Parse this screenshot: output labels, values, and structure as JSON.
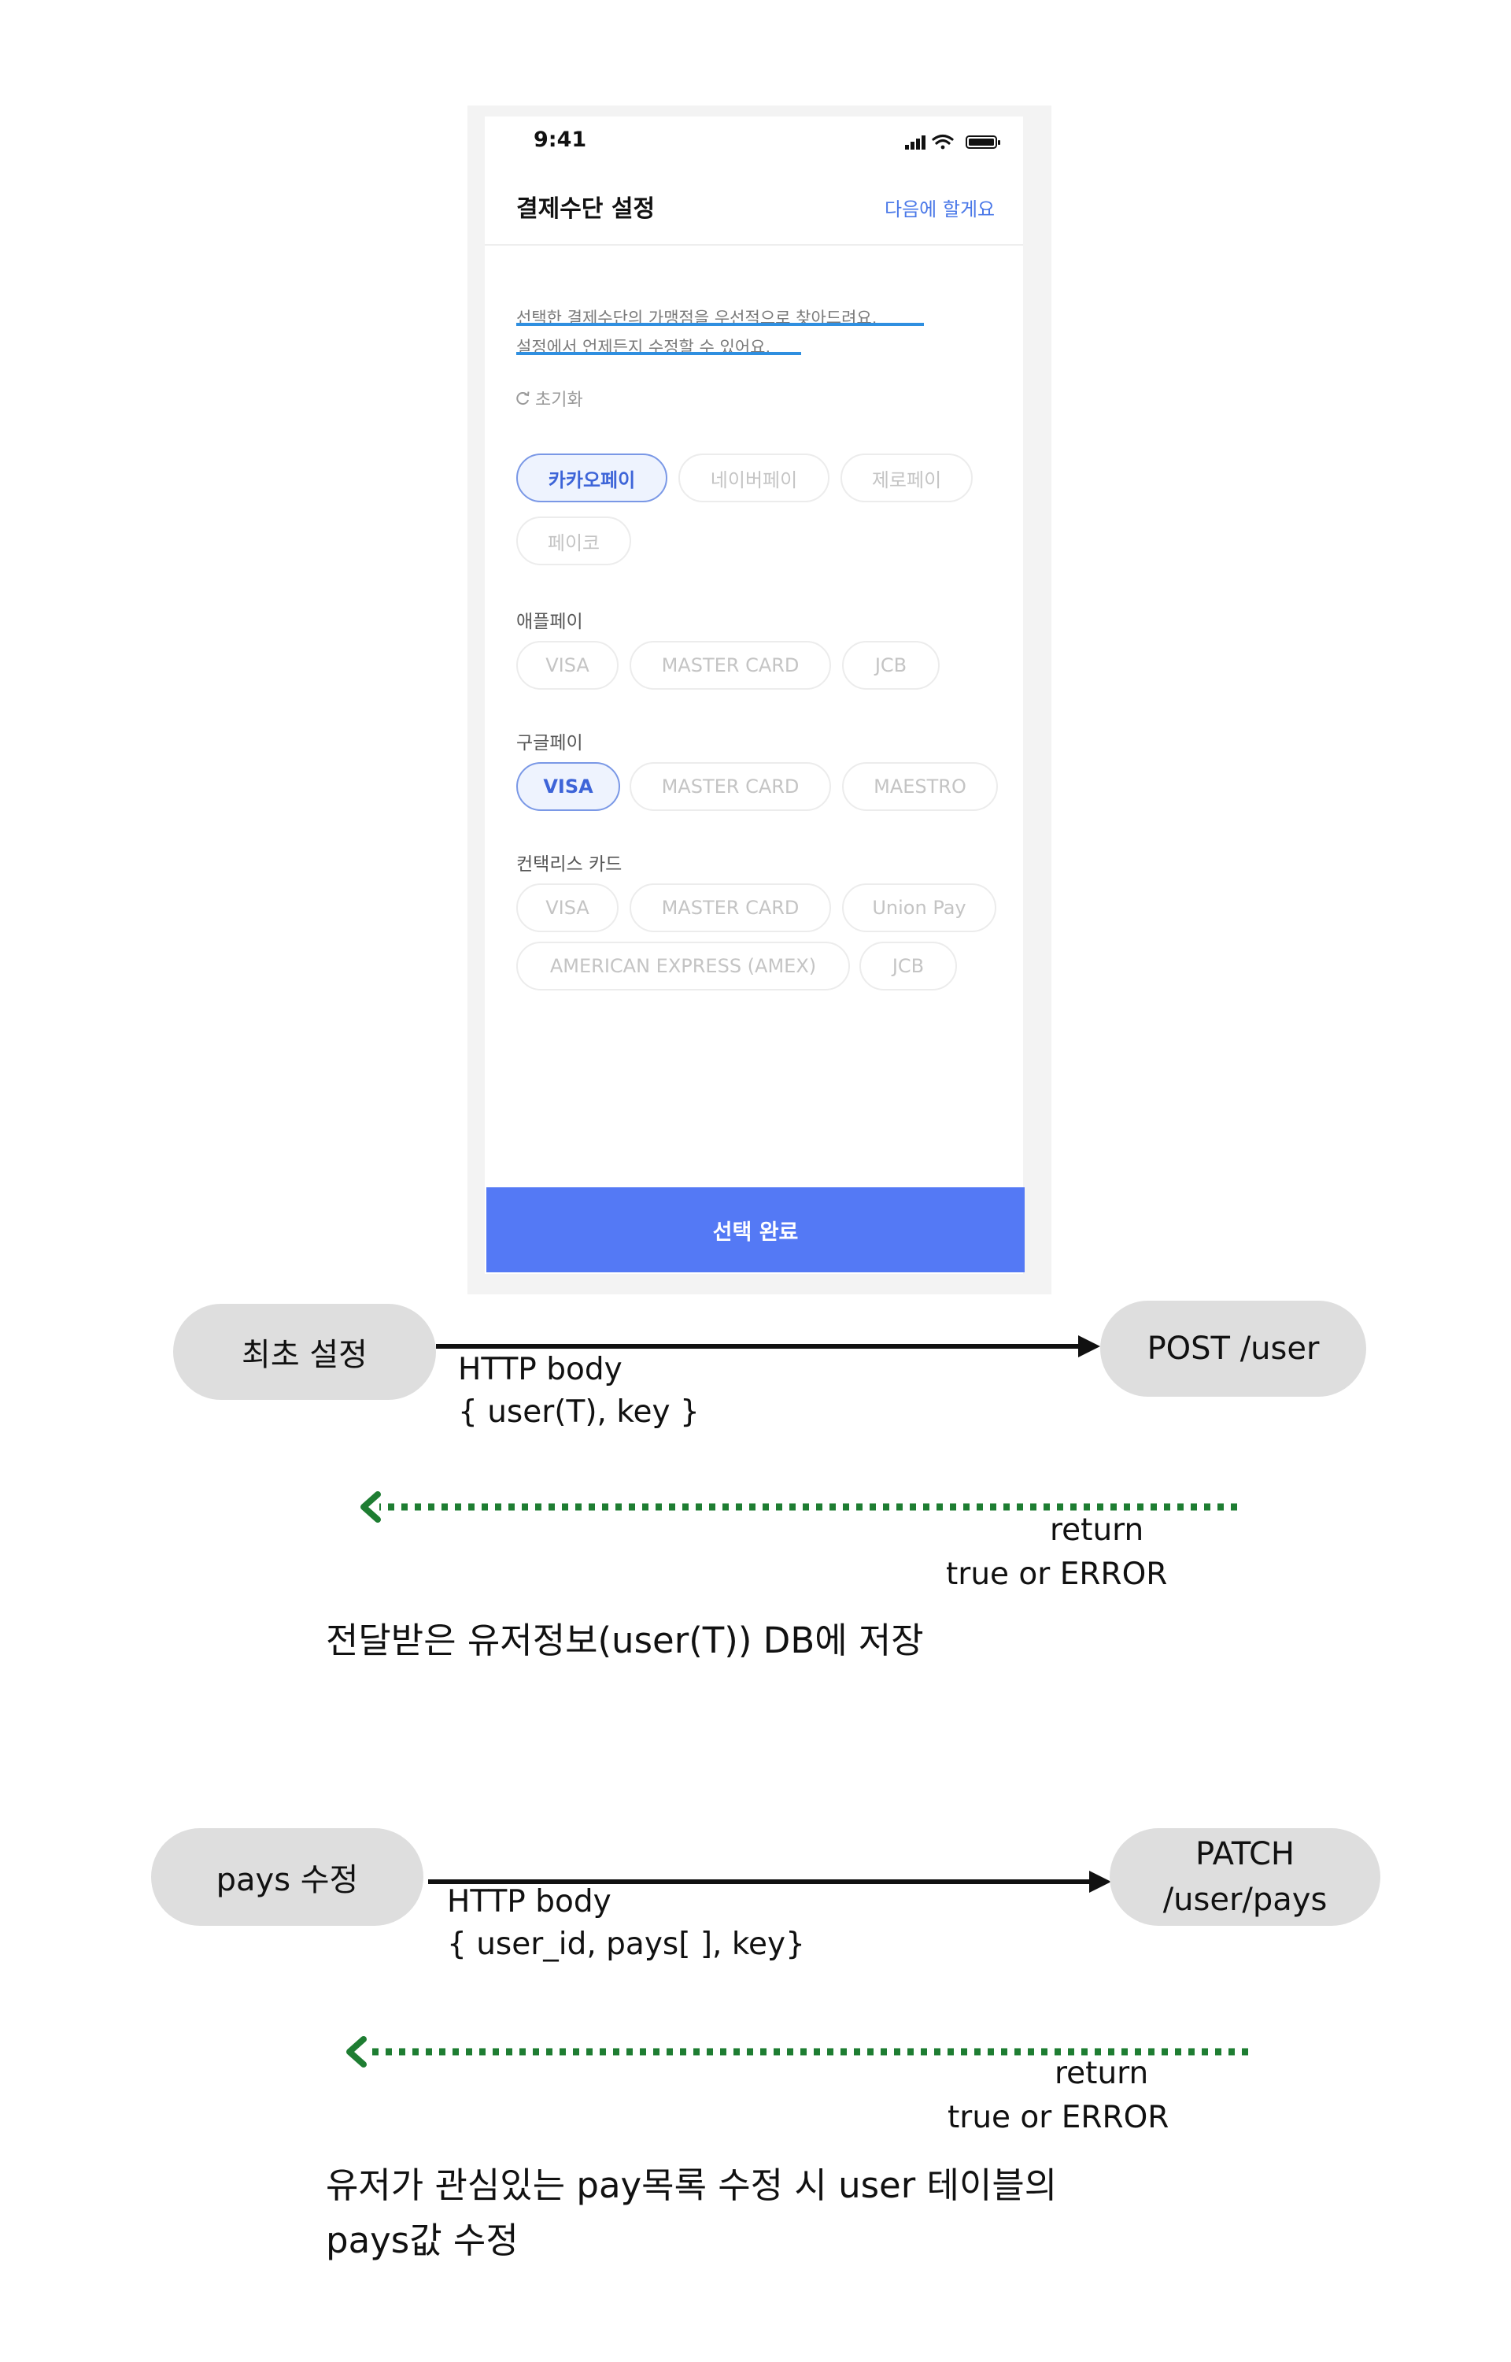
{
  "status_bar": {
    "time": "9:41"
  },
  "header": {
    "title": "결제수단 설정",
    "skip_label": "다음에 할게요"
  },
  "description": {
    "line1": "선택한 결제수단의 가맹점을 우선적으로 찾아드려요.",
    "line2": "설정에서 언제든지 수정할 수 있어요."
  },
  "reset_label": "초기화",
  "top_chips": [
    {
      "label": "카카오페이",
      "selected": true
    },
    {
      "label": "네이버페이",
      "selected": false
    },
    {
      "label": "제로페이",
      "selected": false
    },
    {
      "label": "페이코",
      "selected": false
    }
  ],
  "sections": [
    {
      "title": "애플페이",
      "chips": [
        {
          "label": "VISA",
          "selected": false
        },
        {
          "label": "MASTER CARD",
          "selected": false
        },
        {
          "label": "JCB",
          "selected": false
        }
      ]
    },
    {
      "title": "구글페이",
      "chips": [
        {
          "label": "VISA",
          "selected": true
        },
        {
          "label": "MASTER CARD",
          "selected": false
        },
        {
          "label": "MAESTRO",
          "selected": false
        }
      ]
    },
    {
      "title": "컨택리스 카드",
      "chips": [
        {
          "label": "VISA",
          "selected": false
        },
        {
          "label": "MASTER CARD",
          "selected": false
        },
        {
          "label": "Union Pay",
          "selected": false
        },
        {
          "label": "AMERICAN EXPRESS (AMEX)",
          "selected": false
        },
        {
          "label": "JCB",
          "selected": false
        }
      ]
    }
  ],
  "complete_button": "선택 완료",
  "flow1": {
    "client": "최초 설정",
    "server": "POST /user",
    "request_line1": "HTTP body",
    "request_line2": "{ user(T), key }",
    "return_line1": "return",
    "return_line2": "true or ERROR",
    "note": "전달받은 유저정보(user(T)) DB에 저장"
  },
  "flow2": {
    "client": "pays 수정",
    "server_line1": "PATCH",
    "server_line2": "/user/pays",
    "request_line1": "HTTP body",
    "request_line2": "{ user_id, pays[ ], key}",
    "return_line1": "return",
    "return_line2": "true or ERROR",
    "note_line1": "유저가 관심있는 pay목록 수정 시 user 테이블의",
    "note_line2": "pays값 수정"
  },
  "colors": {
    "primary": "#5479f5",
    "link": "#4a78e8",
    "chip_selected_border": "#7a98e6",
    "chip_selected_bg": "#eef3fe",
    "underline": "#2f8fe0",
    "return_arrow": "#1e7d32",
    "pill_bg": "#dedede"
  },
  "icons": [
    "signal-icon",
    "wifi-icon",
    "battery-icon",
    "refresh-icon",
    "arrow-right-icon",
    "arrow-left-dotted-icon"
  ]
}
